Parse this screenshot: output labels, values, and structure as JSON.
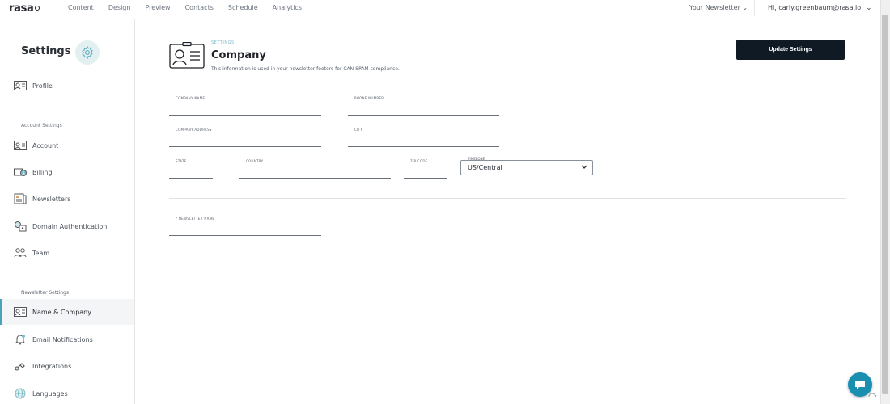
{
  "brand": {
    "logo_text": "rasa"
  },
  "topnav": {
    "items": [
      "Content",
      "Design",
      "Preview",
      "Contacts",
      "Schedule",
      "Analytics"
    ]
  },
  "header": {
    "newsletter_select": "Your Newsletter ⌄",
    "user_greeting": "Hi, carly.greenbaum@rasa.io"
  },
  "sidebar": {
    "title": "Settings",
    "profile": "Profile",
    "account_section": "Account Settings",
    "account_items": [
      "Account",
      "Billing",
      "Newsletters",
      "Domain Authentication",
      "Team"
    ],
    "newsletter_section": "Newsletter Settings",
    "newsletter_items": [
      "Name & Company",
      "Email Notifications",
      "Integrations",
      "Languages"
    ],
    "active_item": "Name & Company"
  },
  "main": {
    "kicker": "SETTINGS",
    "title": "Company",
    "description": "This information is used in your newsletter footers for CAN-SPAM compliance.",
    "update_button": "Update Settings",
    "fields": {
      "company_name": {
        "label": "COMPANY NAME",
        "value": ""
      },
      "phone_number": {
        "label": "PHONE NUMBER",
        "value": ""
      },
      "company_address": {
        "label": "COMPANY ADDRESS",
        "value": ""
      },
      "city": {
        "label": "CITY",
        "value": ""
      },
      "state": {
        "label": "STATE",
        "value": ""
      },
      "country": {
        "label": "COUNTRY",
        "value": ""
      },
      "zip_code": {
        "label": "ZIP CODE",
        "value": ""
      },
      "timezone": {
        "label": "TIMEZONE",
        "value": "US/Central"
      },
      "newsletter_name": {
        "label": "* NEWSLETTER NAME",
        "value": ""
      }
    }
  },
  "colors": {
    "accent": "#4aa3b8",
    "button_bg": "#0f1a24",
    "chat_bubble": "#1a8fb0"
  },
  "icons": {
    "settings": "gear-icon",
    "profile": "id-card-icon",
    "chat": "chat-bubble-icon"
  }
}
